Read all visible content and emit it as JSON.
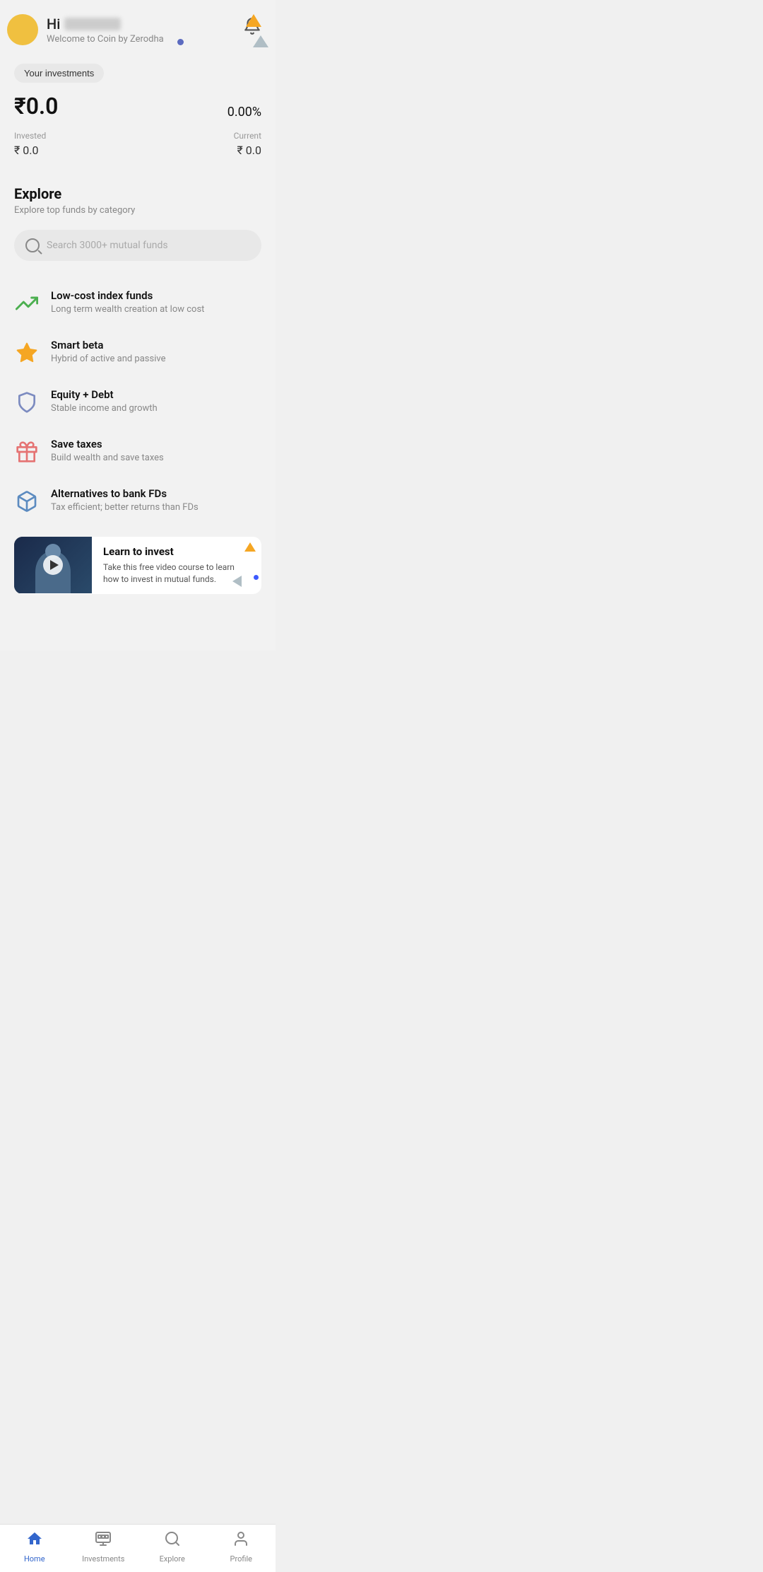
{
  "header": {
    "greeting": "Hi",
    "welcome": "Welcome to Coin by Zerodha",
    "bell_label": "notifications"
  },
  "investments": {
    "section_label": "Your investments",
    "total_value": "₹0.0",
    "percent_change": "0.00%",
    "invested_label": "Invested",
    "invested_value": "₹ 0.0",
    "current_label": "Current",
    "current_value": "₹ 0.0"
  },
  "explore": {
    "title": "Explore",
    "subtitle": "Explore top funds by category",
    "search_placeholder": "Search 3000+ mutual funds",
    "categories": [
      {
        "id": "low-cost-index",
        "title": "Low-cost index funds",
        "description": "Long term wealth creation at low cost",
        "icon": "trending-up"
      },
      {
        "id": "smart-beta",
        "title": "Smart beta",
        "description": "Hybrid of active and passive",
        "icon": "star"
      },
      {
        "id": "equity-debt",
        "title": "Equity + Debt",
        "description": "Stable income and growth",
        "icon": "shield"
      },
      {
        "id": "save-taxes",
        "title": "Save taxes",
        "description": "Build wealth and save taxes",
        "icon": "gift"
      },
      {
        "id": "alternatives-fd",
        "title": "Alternatives to bank FDs",
        "description": "Tax efficient; better returns than FDs",
        "icon": "cube"
      }
    ]
  },
  "learn_banner": {
    "title": "Learn to invest",
    "description": "Take this free video course to learn how to invest in mutual funds."
  },
  "bottom_nav": {
    "items": [
      {
        "id": "home",
        "label": "Home",
        "active": true
      },
      {
        "id": "investments",
        "label": "Investments",
        "active": false
      },
      {
        "id": "explore",
        "label": "Explore",
        "active": false
      },
      {
        "id": "profile",
        "label": "Profile",
        "active": false
      }
    ]
  }
}
